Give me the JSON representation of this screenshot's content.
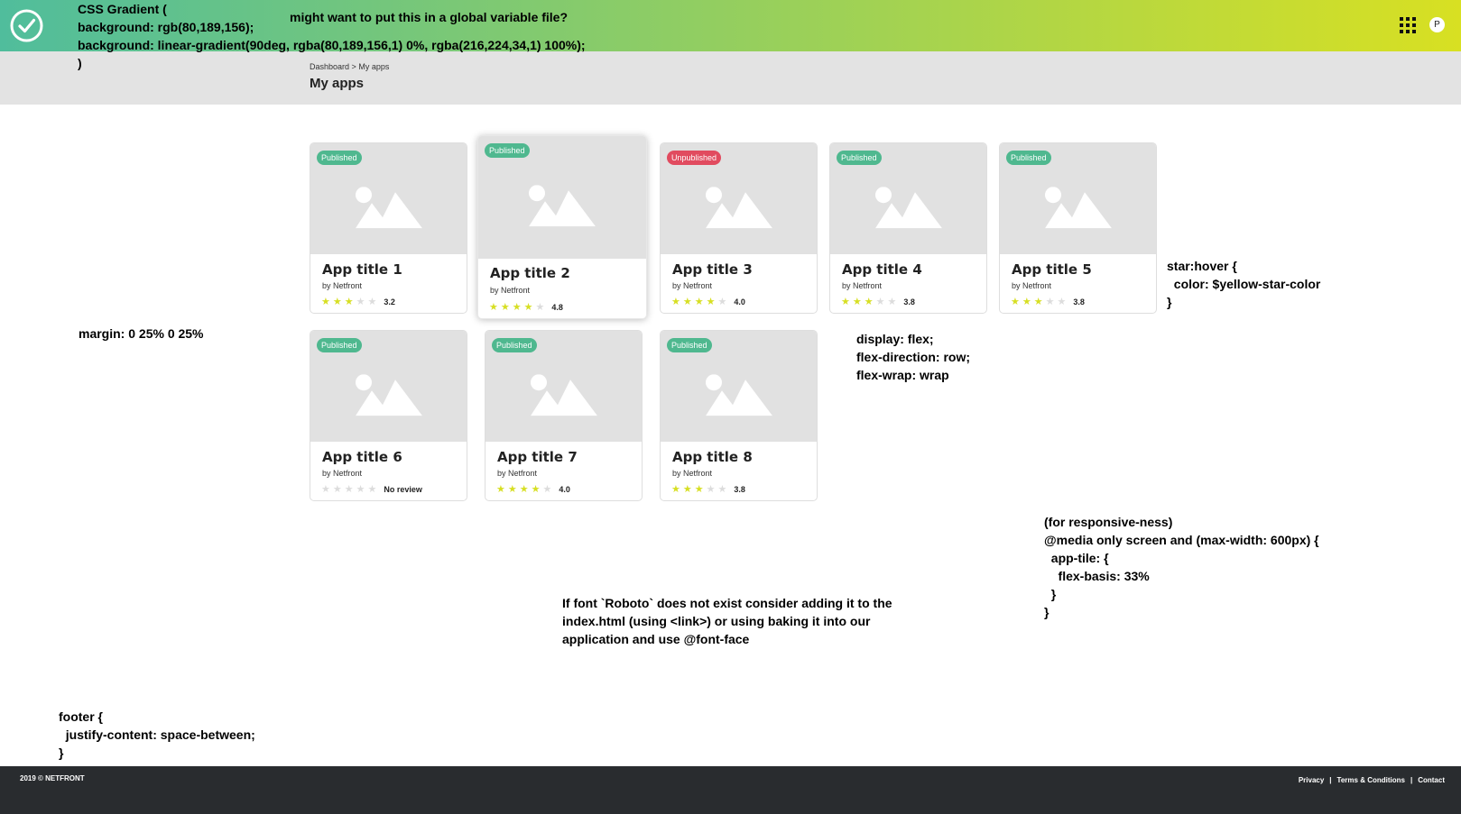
{
  "colors": {
    "gradient_start": "#50bd9c",
    "gradient_end": "#d8e022",
    "published": "#4fb88f",
    "unpublished": "#e14b5f",
    "star_on": "#d7df23",
    "star_off": "#dcdcdc",
    "footer_bg": "#292c2f"
  },
  "header": {
    "logo_icon": "check-circle-icon",
    "apps_icon": "grid-icon",
    "avatar_initial": "P"
  },
  "breadcrumb": {
    "items": [
      "Dashboard",
      "My apps"
    ],
    "separator": ">"
  },
  "page_title": "My apps",
  "apps": [
    {
      "title": "App title 1",
      "author": "by Netfront",
      "status": "Published",
      "stars": 3,
      "rating": "3.2"
    },
    {
      "title": "App title 2",
      "author": "by Netfront",
      "status": "Published",
      "stars": 4,
      "rating": "4.8"
    },
    {
      "title": "App title 3",
      "author": "by Netfront",
      "status": "Unpublished",
      "stars": 4,
      "rating": "4.0"
    },
    {
      "title": "App title 4",
      "author": "by Netfront",
      "status": "Published",
      "stars": 3,
      "rating": "3.8"
    },
    {
      "title": "App title 5",
      "author": "by Netfront",
      "status": "Published",
      "stars": 3,
      "rating": "3.8"
    },
    {
      "title": "App title 6",
      "author": "by Netfront",
      "status": "Published",
      "stars": 0,
      "rating": "No review"
    },
    {
      "title": "App title 7",
      "author": "by Netfront",
      "status": "Published",
      "stars": 4,
      "rating": "4.0"
    },
    {
      "title": "App title 8",
      "author": "by Netfront",
      "status": "Published",
      "stars": 3,
      "rating": "3.8"
    }
  ],
  "annotations": {
    "gradient": "CSS Gradient (\nbackground: rgb(80,189,156);\nbackground: linear-gradient(90deg, rgba(80,189,156,1) 0%, rgba(216,224,34,1) 100%);\n)",
    "global_var": "might want to put this in a global variable file?",
    "margin": "margin: 0 25% 0 25%",
    "star_hover": "star:hover {\n  color: $yellow-star-color\n}",
    "flex": "display: flex;\nflex-direction: row;\nflex-wrap: wrap",
    "responsive": "(for responsive-ness)\n@media only screen and (max-width: 600px) {\n  app-tile: {\n    flex-basis: 33%\n  }\n}",
    "font": "If font `Roboto` does not exist consider adding it to the\nindex.html (using <link>) or using baking it into our\napplication and use @font-face",
    "footer": "footer {\n  justify-content: space-between;\n}"
  },
  "footer": {
    "copyright": "2019 © NETFRONT",
    "links": [
      "Privacy",
      "Terms & Conditions",
      "Contact"
    ],
    "separator": "|"
  }
}
